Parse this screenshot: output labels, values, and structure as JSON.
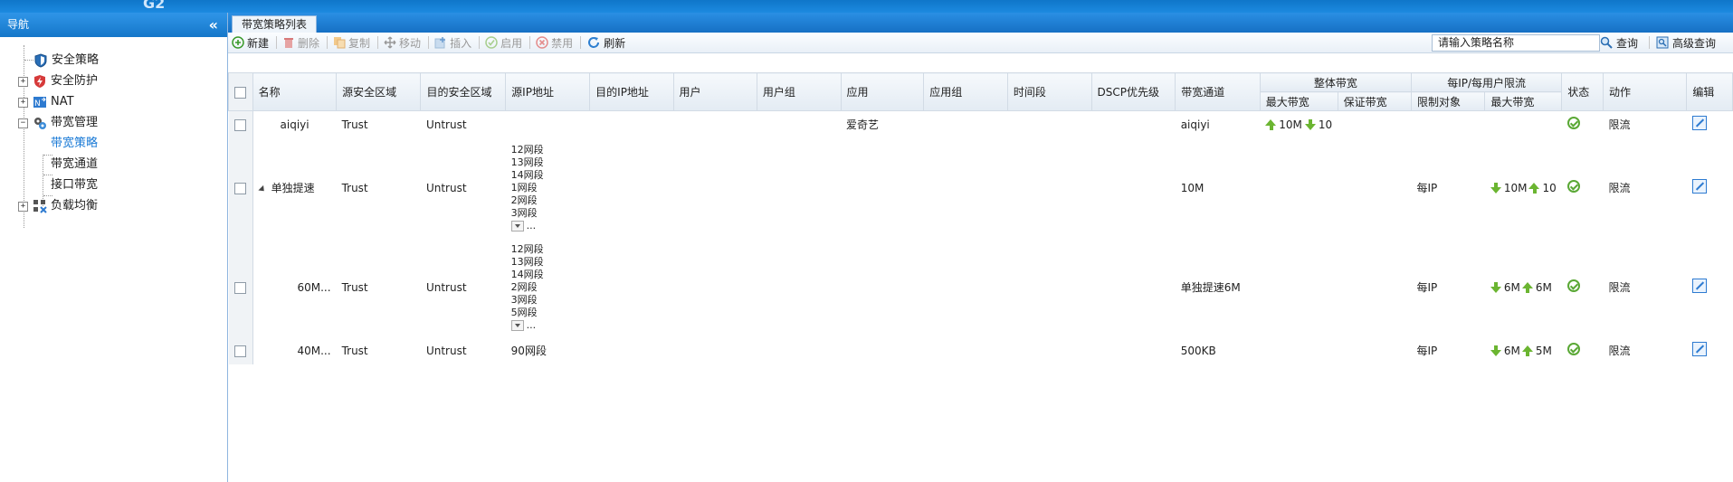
{
  "app": {
    "logo_text": "G2"
  },
  "sidebar": {
    "title": "导航",
    "collapse_icon": "«",
    "items": [
      {
        "label": "安全策略",
        "icon": "shield-icon"
      },
      {
        "label": "安全防护",
        "icon": "protect-icon",
        "expander": "+"
      },
      {
        "label": "NAT",
        "icon": "nat-icon",
        "expander": "+"
      },
      {
        "label": "带宽管理",
        "icon": "bandwidth-icon",
        "expander": "−"
      },
      {
        "label": "带宽策略",
        "active": true
      },
      {
        "label": "带宽通道"
      },
      {
        "label": "接口带宽"
      },
      {
        "label": "负载均衡",
        "icon": "loadbalance-icon",
        "expander": "+"
      }
    ]
  },
  "tab": {
    "label": "带宽策略列表"
  },
  "toolbar": {
    "new": "新建",
    "delete": "删除",
    "copy": "复制",
    "move": "移动",
    "insert": "插入",
    "enable": "启用",
    "disable": "禁用",
    "refresh": "刷新",
    "search_value": "请输入策略名称",
    "query": "查询",
    "advanced_query": "高级查询"
  },
  "table": {
    "headers": {
      "name": "名称",
      "src_zone": "源安全区域",
      "dst_zone": "目的安全区域",
      "src_ip": "源IP地址",
      "dst_ip": "目的IP地址",
      "user": "用户",
      "user_group": "用户组",
      "app": "应用",
      "app_group": "应用组",
      "time": "时间段",
      "dscp": "DSCP优先级",
      "channel": "带宽通道",
      "overall": "整体带宽",
      "max_bw": "最大带宽",
      "guaranteed_bw": "保证带宽",
      "per_ip": "每IP/每用户限流",
      "limit_target": "限制对象",
      "per_max_bw": "最大带宽",
      "status": "状态",
      "action": "动作",
      "edit": "编辑"
    },
    "rows": [
      {
        "name": "aiqiyi",
        "src_zone": "Trust",
        "dst_zone": "Untrust",
        "src_ip": [],
        "app": "爱奇艺",
        "channel": "aiqiyi",
        "overall_up": "10M",
        "overall_down": "10",
        "limit_target": "",
        "per_down": "",
        "per_up": "",
        "action": "限流"
      },
      {
        "name": "单独提速",
        "src_zone": "Trust",
        "dst_zone": "Untrust",
        "src_ip": [
          "12网段",
          "13网段",
          "14网段",
          "1网段",
          "2网段",
          "3网段"
        ],
        "src_ip_more": "...",
        "app": "",
        "channel": "10M",
        "overall_up": "",
        "overall_down": "",
        "limit_target": "每IP",
        "per_down": "10M",
        "per_up": "10",
        "action": "限流"
      },
      {
        "name": "60M...",
        "src_zone": "Trust",
        "dst_zone": "Untrust",
        "src_ip": [
          "12网段",
          "13网段",
          "14网段",
          "2网段",
          "3网段",
          "5网段"
        ],
        "src_ip_more": "...",
        "app": "",
        "channel": "单独提速6M",
        "overall_up": "",
        "overall_down": "",
        "limit_target": "每IP",
        "per_down": "6M",
        "per_up": "6M",
        "action": "限流"
      },
      {
        "name": "40M...",
        "src_zone": "Trust",
        "dst_zone": "Untrust",
        "src_ip": [
          "90网段"
        ],
        "app": "",
        "channel": "500KB",
        "overall_up": "",
        "overall_down": "",
        "limit_target": "每IP",
        "per_down": "6M",
        "per_up": "5M",
        "action": "限流"
      }
    ]
  },
  "colors": {
    "header_blue": "#1c8ae0",
    "accent_green": "#6bb531",
    "active_link": "#1a7ad6"
  }
}
